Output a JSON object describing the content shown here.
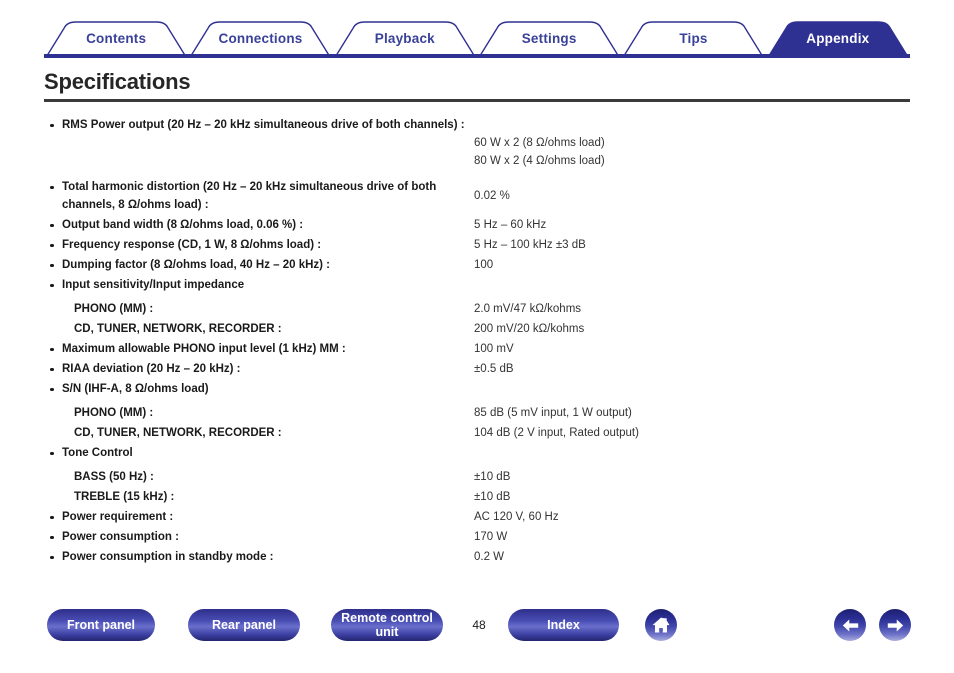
{
  "tabbar": {
    "tabs": [
      {
        "label": "Contents",
        "active": false
      },
      {
        "label": "Connections",
        "active": false
      },
      {
        "label": "Playback",
        "active": false
      },
      {
        "label": "Settings",
        "active": false
      },
      {
        "label": "Tips",
        "active": false
      },
      {
        "label": "Appendix",
        "active": true
      }
    ],
    "accent_color": "#2e3192",
    "tab_text_color": "#3a4199",
    "active_tab_text_color": "#ffffff"
  },
  "page": {
    "title": "Specifications"
  },
  "specs": [
    {
      "label": "RMS Power output (20 Hz – 20 kHz simultaneous drive of both channels) :",
      "bulleted": true,
      "sub": false,
      "values": [
        "60 W x 2 (8 Ω/ohms load)",
        "80 W x 2 (4 Ω/ohms load)"
      ]
    },
    {
      "label": "Total harmonic distortion (20 Hz – 20 kHz simultaneous drive of both channels, 8 Ω/ohms load) :",
      "bulleted": true,
      "sub": false,
      "values": [
        "0.02 %"
      ]
    },
    {
      "label": "Output band width (8 Ω/ohms load, 0.06 %) :",
      "bulleted": true,
      "sub": false,
      "values": [
        "5 Hz – 60 kHz"
      ]
    },
    {
      "label": "Frequency response (CD, 1 W, 8 Ω/ohms load) :",
      "bulleted": true,
      "sub": false,
      "values": [
        "5 Hz – 100 kHz ±3 dB"
      ]
    },
    {
      "label": "Dumping factor (8 Ω/ohms load, 40 Hz – 20 kHz) :",
      "bulleted": true,
      "sub": false,
      "values": [
        "100"
      ]
    },
    {
      "label": "Input sensitivity/Input impedance",
      "bulleted": true,
      "sub": false,
      "values": [
        ""
      ]
    },
    {
      "label": "PHONO (MM) :",
      "bulleted": false,
      "sub": true,
      "values": [
        "2.0 mV/47 kΩ/kohms"
      ]
    },
    {
      "label": "CD, TUNER, NETWORK, RECORDER :",
      "bulleted": false,
      "sub": true,
      "values": [
        "200 mV/20 kΩ/kohms"
      ]
    },
    {
      "label": "Maximum allowable PHONO input level (1 kHz) MM :",
      "bulleted": true,
      "sub": false,
      "values": [
        "100 mV"
      ]
    },
    {
      "label": "RIAA deviation (20 Hz – 20 kHz) :",
      "bulleted": true,
      "sub": false,
      "values": [
        "±0.5 dB"
      ]
    },
    {
      "label": "S/N (IHF-A, 8 Ω/ohms load)",
      "bulleted": true,
      "sub": false,
      "values": [
        ""
      ]
    },
    {
      "label": "PHONO (MM) :",
      "bulleted": false,
      "sub": true,
      "values": [
        "85 dB (5 mV input, 1 W output)"
      ]
    },
    {
      "label": "CD, TUNER, NETWORK, RECORDER :",
      "bulleted": false,
      "sub": true,
      "values": [
        "104 dB (2 V input, Rated output)"
      ]
    },
    {
      "label": "Tone Control",
      "bulleted": true,
      "sub": false,
      "values": [
        ""
      ]
    },
    {
      "label": "BASS (50 Hz) :",
      "bulleted": false,
      "sub": true,
      "values": [
        "±10 dB"
      ]
    },
    {
      "label": "TREBLE (15 kHz) :",
      "bulleted": false,
      "sub": true,
      "values": [
        "±10 dB"
      ]
    },
    {
      "label": "Power requirement :",
      "bulleted": true,
      "sub": false,
      "values": [
        "AC 120 V, 60 Hz"
      ]
    },
    {
      "label": "Power consumption :",
      "bulleted": true,
      "sub": false,
      "values": [
        "170 W"
      ]
    },
    {
      "label": "Power consumption in standby mode :",
      "bulleted": true,
      "sub": false,
      "values": [
        "0.2 W"
      ]
    }
  ],
  "footer": {
    "front_panel_label": "Front panel",
    "rear_panel_label": "Rear panel",
    "remote_control_label": "Remote control unit",
    "page_number": "48",
    "index_label": "Index",
    "home_icon": "home-icon",
    "prev_icon": "arrow-left-icon",
    "next_icon": "arrow-right-icon",
    "button_color": "#2e3192"
  }
}
